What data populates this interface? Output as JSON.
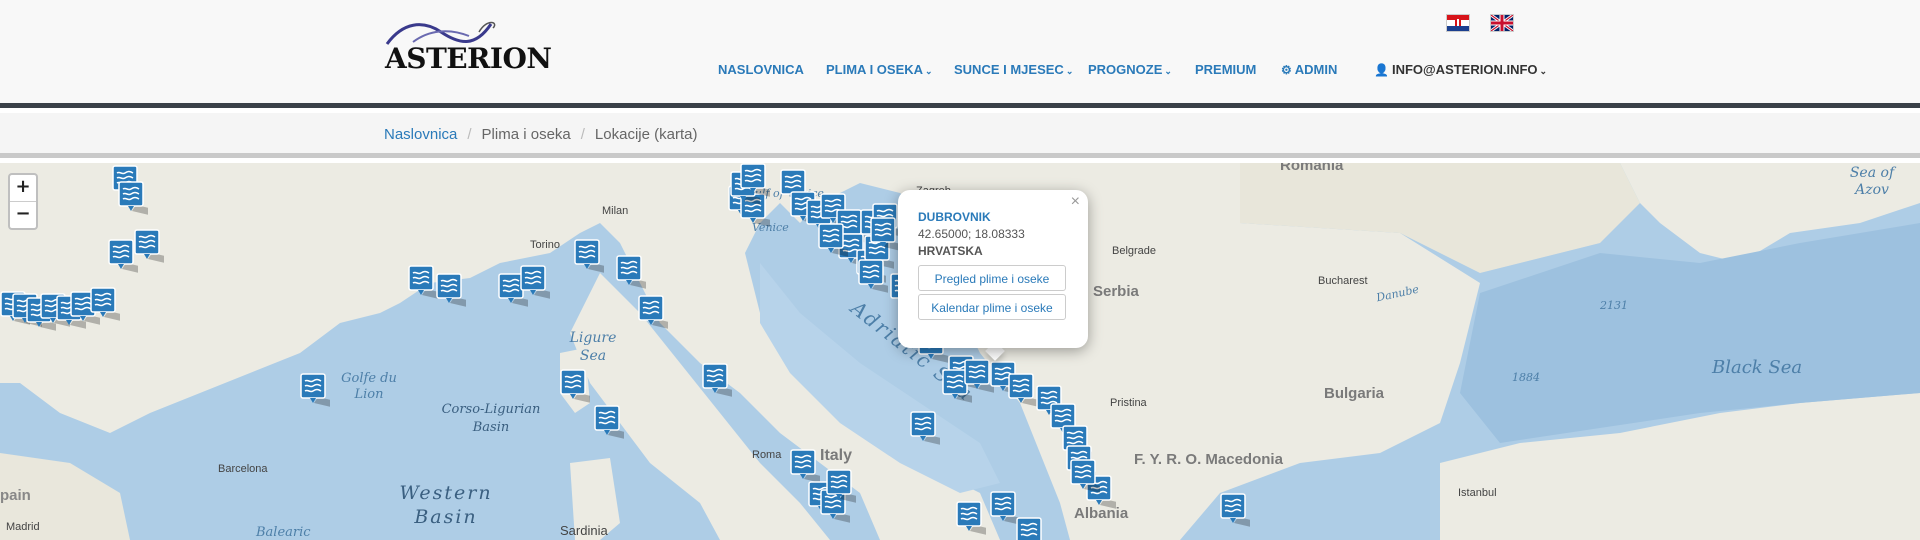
{
  "brand": {
    "logo_text": "ASTERION"
  },
  "languages": [
    {
      "code": "hr",
      "icon": "croatian-flag-icon"
    },
    {
      "code": "en",
      "icon": "uk-flag-icon"
    }
  ],
  "nav": {
    "items": [
      {
        "label": "NASLOVNICA",
        "has_dropdown": false
      },
      {
        "label": "PLIMA I OSEKA",
        "has_dropdown": true
      },
      {
        "label": "SUNCE I MJESEC",
        "has_dropdown": true
      },
      {
        "label": "PROGNOZE",
        "has_dropdown": true
      },
      {
        "label": "PREMIUM",
        "has_dropdown": false
      },
      {
        "label": "ADMIN",
        "has_dropdown": false,
        "icon": "cogs-icon"
      },
      {
        "label": "INFO@ASTERION.INFO",
        "has_dropdown": true,
        "icon": "user-icon"
      }
    ],
    "caret": "⌄"
  },
  "breadcrumb": {
    "items": [
      "Naslovnica",
      "Plima i oseka",
      "Lokacije (karta)"
    ],
    "separator": "/"
  },
  "map": {
    "zoom_in": "+",
    "zoom_out": "−",
    "city_labels": [
      "Milan",
      "Torino",
      "Zagreb",
      "Belgrade",
      "Bucharest",
      "Pristina",
      "Barcelona",
      "Madrid",
      "Istanbul",
      "Roma",
      "Venice"
    ],
    "country_labels": [
      "Serbia",
      "Bulgaria",
      "Italy",
      "F. Y. R. O. Macedonia",
      "Albania",
      "Romania",
      "pain",
      "Sardinia",
      "Balearic"
    ],
    "sea_labels": [
      "Adriatic Sea",
      "Black Sea",
      "Western Basin",
      "Corso-Ligurian Basin",
      "Ligure Sea",
      "Golfe du Lion",
      "Gulf of Venice",
      "Sea of Azov",
      "Danube",
      "2131",
      "1884",
      "Baleario"
    ],
    "marker_icon": "tide-station-icon",
    "colors": {
      "water": "#aecde6",
      "land": "#ecebe3",
      "marker": "#2a7ab9"
    }
  },
  "popup": {
    "title": "DUBROVNIK",
    "coords": "42.65000; 18.08333",
    "country": "HRVATSKA",
    "btn_overview": "Pregled plime i oseke",
    "btn_calendar": "Kalendar plime i oseke",
    "close": "×"
  }
}
